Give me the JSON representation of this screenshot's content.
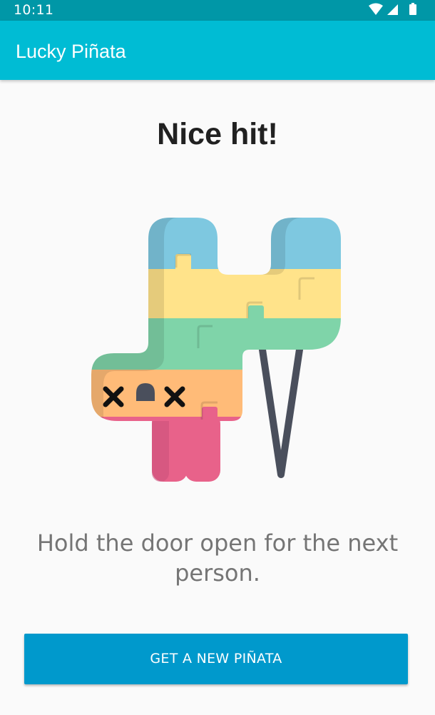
{
  "status_bar": {
    "time": "10:11",
    "icons": [
      "wifi-icon",
      "cellular-signal-icon",
      "battery-icon"
    ]
  },
  "app_bar": {
    "title": "Lucky Piñata"
  },
  "main": {
    "headline": "Nice hit!",
    "illustration": "broken-pinata-illustration",
    "message": "Hold the door open for the next person.",
    "button_label": "GET A NEW PIÑATA"
  },
  "colors": {
    "status_bar": "#0097a7",
    "app_bar": "#00bcd4",
    "button": "#0099cc",
    "background": "#fafafa",
    "headline_text": "#212121",
    "message_text": "#757575",
    "pinata_blue": "#7ec8e0",
    "pinata_yellow": "#ffe38a",
    "pinata_green": "#7fd4a9",
    "pinata_orange": "#ffbb78",
    "pinata_pink": "#e8628a",
    "string": "#4a4f5c"
  }
}
